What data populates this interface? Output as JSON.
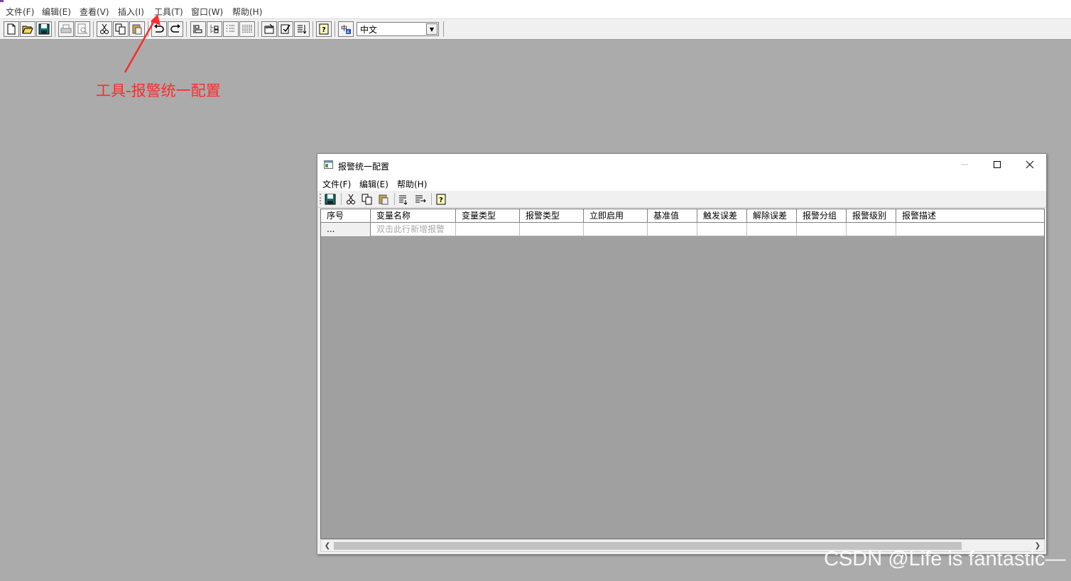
{
  "menubar": {
    "items": [
      "文件(F)",
      "编辑(E)",
      "查看(V)",
      "插入(I)",
      "工具(T)",
      "窗口(W)",
      "帮助(H)"
    ]
  },
  "toolbar": {
    "language": "中文",
    "icons": [
      "new-file-icon",
      "open-folder-icon",
      "save-icon",
      "print-icon",
      "print-preview-icon",
      "cut-icon",
      "copy-icon",
      "paste-icon",
      "undo-icon",
      "redo-icon",
      "align-icon",
      "tree-icon",
      "list-icon",
      "grid-icon",
      "properties-icon",
      "check-icon",
      "sort-icon",
      "help-icon",
      "translate-icon"
    ]
  },
  "annotation": {
    "text": "工具-报警统一配置",
    "color": "#ff2a2a"
  },
  "dialog": {
    "title": "报警统一配置",
    "menu": [
      "文件(F)",
      "编辑(E)",
      "帮助(H)"
    ],
    "toolbar_icons": [
      "save-icon",
      "cut-icon",
      "copy-icon",
      "paste-icon",
      "insert-row-icon",
      "append-row-icon",
      "help-icon"
    ],
    "table": {
      "columns": [
        "序号",
        "变量名称",
        "变量类型",
        "报警类型",
        "立即启用",
        "基准值",
        "触发误差",
        "解除误差",
        "报警分组",
        "报警级别",
        "报警描述"
      ],
      "rows": [
        {
          "index": "...",
          "name": "双击此行新增报警"
        }
      ]
    }
  },
  "watermark": "CSDN @Life is fantastic—"
}
